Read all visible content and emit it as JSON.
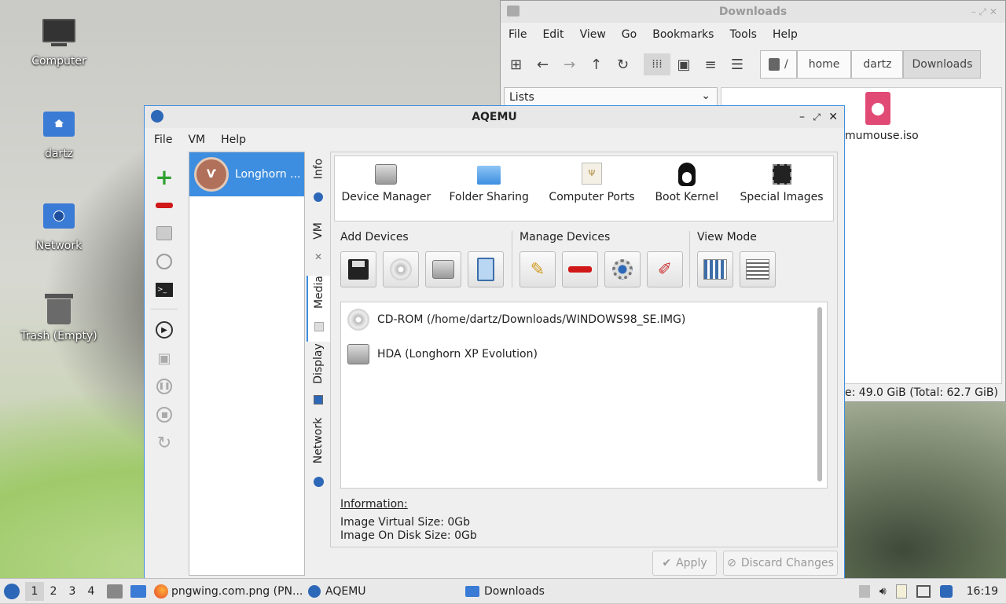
{
  "desktop": {
    "icons": [
      {
        "label": "Computer"
      },
      {
        "label": "dartz"
      },
      {
        "label": "Network"
      },
      {
        "label": "Trash (Empty)"
      }
    ]
  },
  "filemanager": {
    "title": "Downloads",
    "menu": [
      "File",
      "Edit",
      "View",
      "Go",
      "Bookmarks",
      "Tools",
      "Help"
    ],
    "path": [
      "/",
      "home",
      "dartz",
      "Downloads"
    ],
    "sidepane_mode": "Lists",
    "files": [
      {
        "name": "mumouse.iso"
      }
    ],
    "status": "e: 49.0 GiB (Total: 62.7 GiB)"
  },
  "aqemu": {
    "title": "AQEMU",
    "menu": [
      "File",
      "VM",
      "Help"
    ],
    "vm_list": [
      {
        "name": "Longhorn ..."
      }
    ],
    "side_tabs": [
      "Info",
      "VM",
      "Media",
      "Display",
      "Network"
    ],
    "active_tab": "Media",
    "top_buttons": [
      {
        "label": "Device Manager",
        "icon": "hard-disk-icon"
      },
      {
        "label": "Folder Sharing",
        "icon": "folder-icon"
      },
      {
        "label": "Computer Ports",
        "icon": "usb-drive-icon"
      },
      {
        "label": "Boot Kernel",
        "icon": "tux-icon"
      },
      {
        "label": "Special Images",
        "icon": "chip-icon"
      }
    ],
    "add_devices_label": "Add Devices",
    "manage_devices_label": "Manage Devices",
    "view_mode_label": "View Mode",
    "devices": [
      {
        "label": "CD-ROM (/home/dartz/Downloads/WINDOWS98_SE.IMG)",
        "icon": "cdrom-icon"
      },
      {
        "label": "HDA (Longhorn XP Evolution)",
        "icon": "hdd-icon"
      }
    ],
    "info_title": "Information:",
    "info_lines": [
      "Image Virtual Size: 0Gb",
      "Image On Disk Size: 0Gb"
    ],
    "apply_label": "Apply",
    "discard_label": "Discard Changes"
  },
  "taskbar": {
    "workspaces": [
      "1",
      "2",
      "3",
      "4"
    ],
    "tasks": [
      {
        "label": "pngwing.com.png (PN..."
      },
      {
        "label": "AQEMU"
      },
      {
        "label": "Downloads"
      }
    ],
    "clock": "16:19"
  }
}
